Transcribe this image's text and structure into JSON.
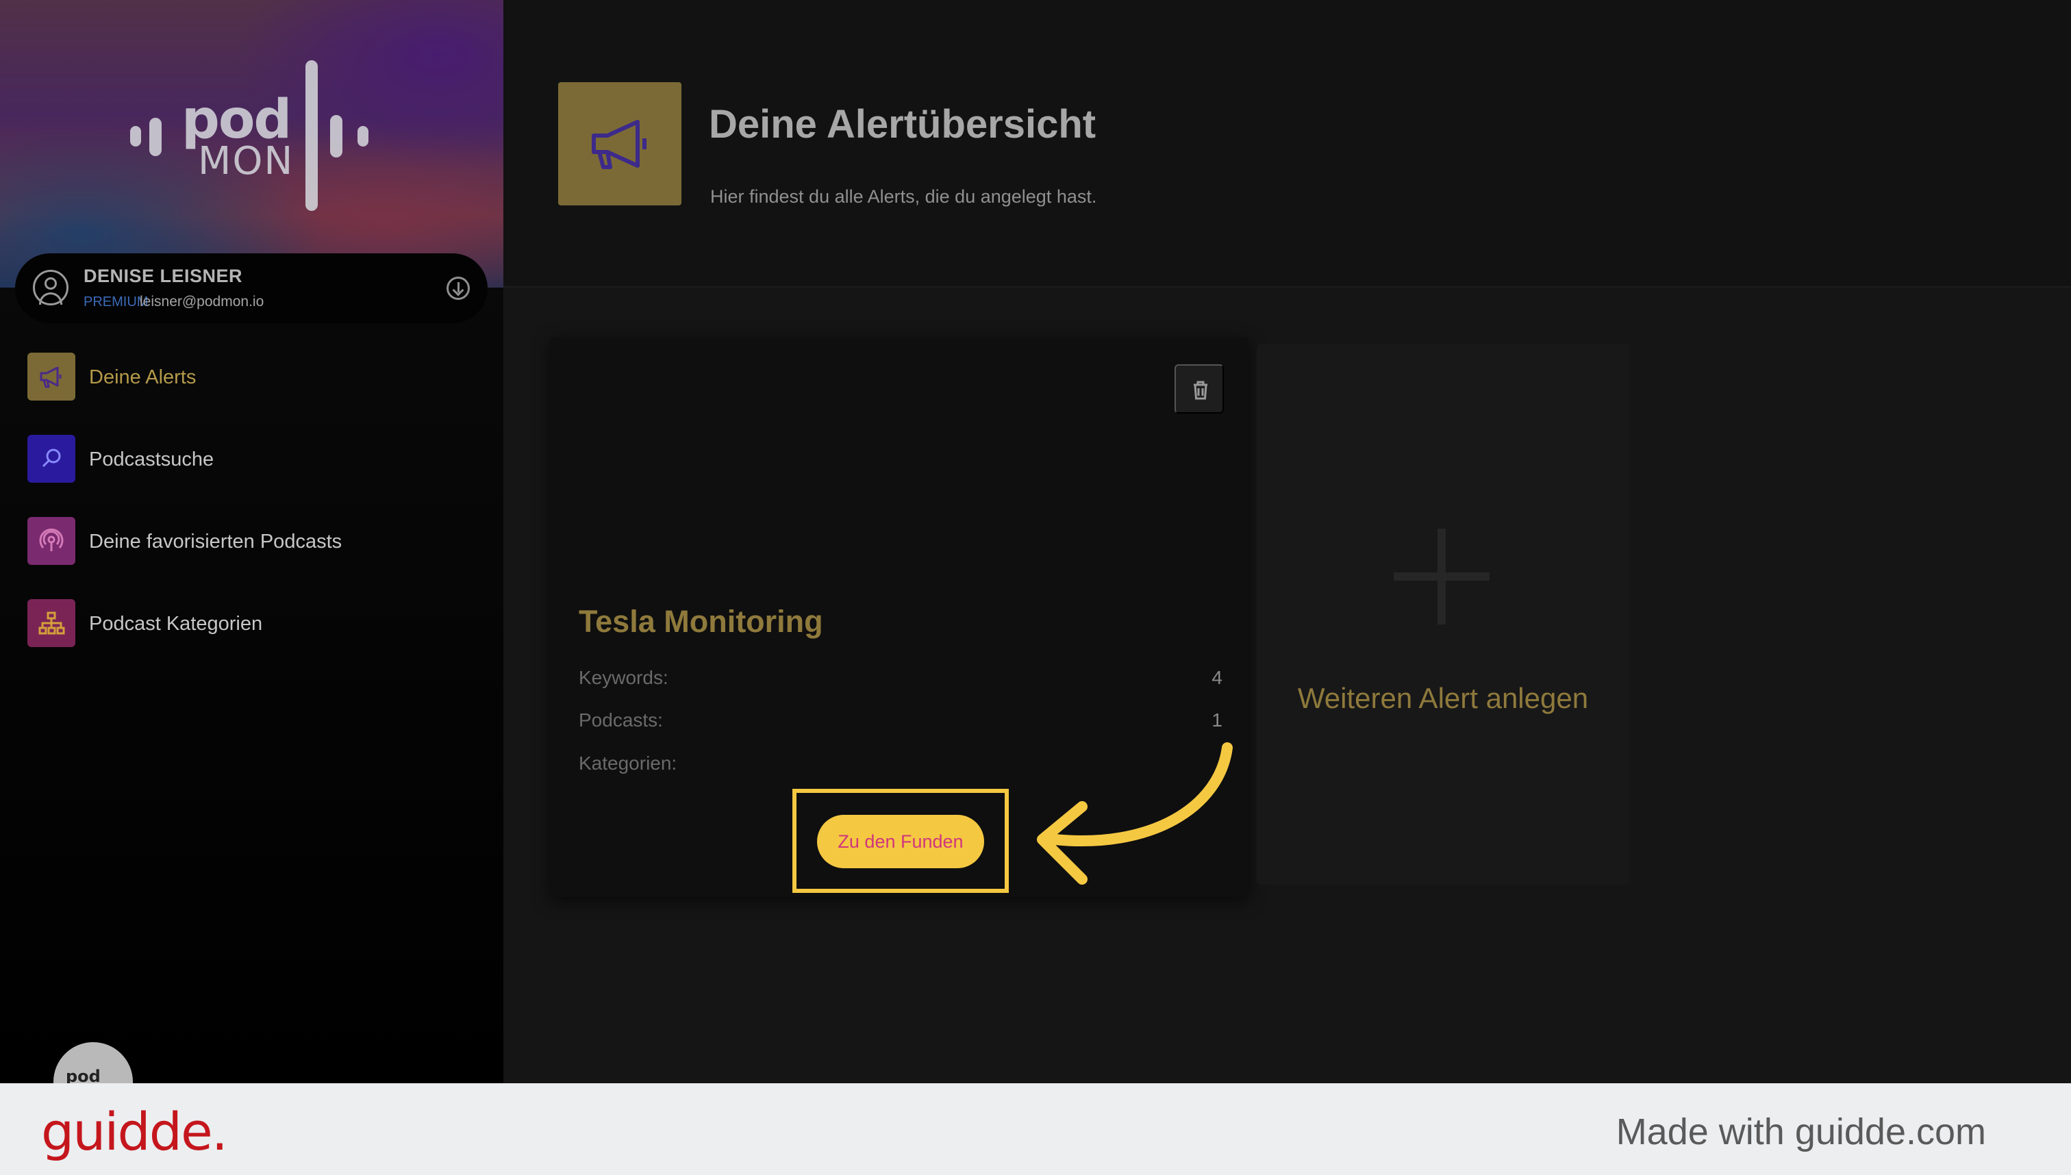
{
  "sidebar": {
    "logo": {
      "line1": "pod",
      "line2": "MON"
    },
    "user": {
      "name": "DENISE LEISNER",
      "tier": "PREMIUM",
      "email": "leisner@podmon.io"
    },
    "nav": [
      {
        "label": "Deine Alerts",
        "icon": "megaphone-icon",
        "color": "#7b6a35",
        "active": true
      },
      {
        "label": "Podcastsuche",
        "icon": "search-icon",
        "color": "#2a1a9e",
        "active": false
      },
      {
        "label": "Deine favorisierten Podcasts",
        "icon": "podcast-icon",
        "color": "#7a2a6e",
        "active": false
      },
      {
        "label": "Podcast Kategorien",
        "icon": "hierarchy-icon",
        "color": "#7a2456",
        "active": false
      }
    ],
    "badge_text": "pod"
  },
  "header": {
    "title": "Deine Alertübersicht",
    "subtitle": "Hier findest du alle Alerts, die du angelegt hast.",
    "icon": "megaphone-icon"
  },
  "alert_card": {
    "title": "Tesla Monitoring",
    "stats": [
      {
        "label": "Keywords:",
        "value": "4"
      },
      {
        "label": "Podcasts:",
        "value": "1"
      },
      {
        "label": "Kategorien:",
        "value": ""
      }
    ],
    "cta_label": "Zu den Funden"
  },
  "new_alert": {
    "label": "Weiteren Alert anlegen"
  },
  "footer": {
    "brand": "guidde.",
    "made_with": "Made with guidde.com"
  },
  "colors": {
    "accent_gold": "#8f7a3c",
    "highlight_yellow": "#f5c842",
    "cta_text": "#d0367c",
    "footer_brand": "#c4161c"
  }
}
